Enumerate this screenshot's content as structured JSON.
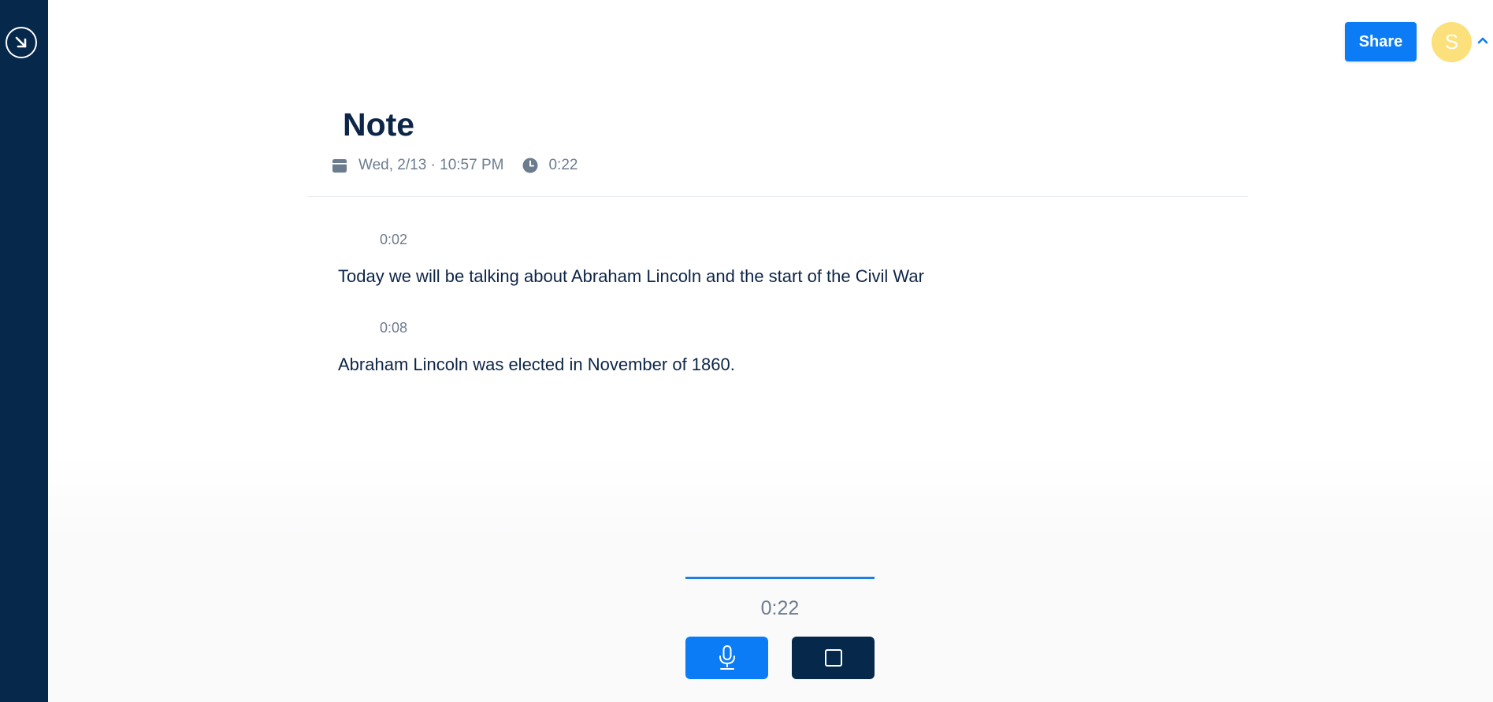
{
  "sidebar": {
    "toggle_icon": "arrow-down-right-circle-icon",
    "background_color": "#06284b"
  },
  "header": {
    "share_label": "Share",
    "avatar_initial": "S",
    "avatar_color": "#fbe07b",
    "accent_color": "#0b7cf6",
    "chevron_icon": "chevron-up-icon"
  },
  "note": {
    "title": "Note",
    "date_icon": "calendar-icon",
    "date": "Wed, 2/13 · 10:57 PM",
    "duration_icon": "clock-icon",
    "duration": "0:22"
  },
  "transcript": [
    {
      "timestamp": "0:02",
      "text": "Today we will be talking about Abraham Lincoln and the start of the Civil War"
    },
    {
      "timestamp": "0:08",
      "text": "Abraham Lincoln was elected in November of 1860."
    }
  ],
  "recorder": {
    "elapsed": "0:22",
    "mic_icon": "microphone-icon",
    "stop_icon": "stop-icon"
  }
}
